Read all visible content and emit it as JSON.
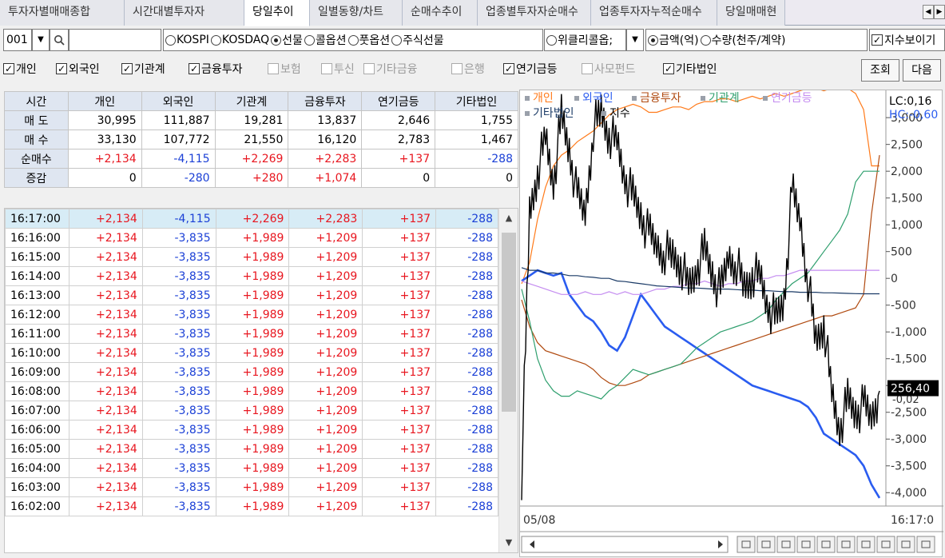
{
  "tabs": [
    {
      "label": "투자자별매매종합",
      "active": false
    },
    {
      "label": "시간대별투자자",
      "active": false
    },
    {
      "label": "당일추이",
      "active": true
    },
    {
      "label": "일별동향/차트",
      "active": false
    },
    {
      "label": "순매수추이",
      "active": false
    },
    {
      "label": "업종별투자자순매수",
      "active": false
    },
    {
      "label": "업종투자자누적순매수",
      "active": false
    },
    {
      "label": "당일매매현",
      "active": false
    }
  ],
  "tab_scroll": {
    "left": "◀",
    "right": "▶"
  },
  "controls": {
    "code_value": "001",
    "dropdown_glyph": "▼",
    "search_glyph": "🔍",
    "markets": [
      {
        "label": "KOSPI",
        "selected": false
      },
      {
        "label": "KOSDAQ",
        "selected": false
      },
      {
        "label": "선물",
        "selected": true
      },
      {
        "label": "콜옵션",
        "selected": false
      },
      {
        "label": "풋옵션",
        "selected": false
      },
      {
        "label": "주식선물",
        "selected": false
      }
    ],
    "weekly_option": {
      "label": "위클리콜옵;",
      "selected": false
    },
    "unit_options": [
      {
        "label": "금액(억)",
        "selected": true
      },
      {
        "label": "수량(천주/계약)",
        "selected": false
      }
    ],
    "show_index": {
      "label": "지수보이기",
      "checked": true
    },
    "check_mark": "✓"
  },
  "investor_checks": [
    {
      "label": "개인",
      "checked": true
    },
    {
      "label": "외국인",
      "checked": true
    },
    {
      "label": "기관계",
      "checked": true
    },
    {
      "label": "금융투자",
      "checked": true
    },
    {
      "label": "보험",
      "checked": false
    },
    {
      "label": "투신",
      "checked": false
    },
    {
      "label": "기타금융",
      "checked": false
    },
    {
      "label": "은행",
      "checked": false
    },
    {
      "label": "연기금등",
      "checked": true
    },
    {
      "label": "사모펀드",
      "checked": false
    },
    {
      "label": "기타법인",
      "checked": true
    }
  ],
  "buttons": {
    "query": "조회",
    "next": "다음"
  },
  "summary": {
    "headers": [
      "시간",
      "개인",
      "외국인",
      "기관계",
      "금융투자",
      "연기금등",
      "기타법인"
    ],
    "rows": [
      {
        "label": "매 도",
        "values": [
          "30,995",
          "111,887",
          "19,281",
          "13,837",
          "2,646",
          "1,755"
        ]
      },
      {
        "label": "매 수",
        "values": [
          "33,130",
          "107,772",
          "21,550",
          "16,120",
          "2,783",
          "1,467"
        ]
      },
      {
        "label": "순매수",
        "values": [
          "+2,134",
          "-4,115",
          "+2,269",
          "+2,283",
          "+137",
          "-288"
        ]
      },
      {
        "label": "증감",
        "values": [
          "0",
          "-280",
          "+280",
          "+1,074",
          "0",
          "0"
        ]
      }
    ]
  },
  "time_rows": [
    {
      "time": "16:17:00",
      "values": [
        "+2,134",
        "-4,115",
        "+2,269",
        "+2,283",
        "+137",
        "-288"
      ]
    },
    {
      "time": "16:16:00",
      "values": [
        "+2,134",
        "-3,835",
        "+1,989",
        "+1,209",
        "+137",
        "-288"
      ]
    },
    {
      "time": "16:15:00",
      "values": [
        "+2,134",
        "-3,835",
        "+1,989",
        "+1,209",
        "+137",
        "-288"
      ]
    },
    {
      "time": "16:14:00",
      "values": [
        "+2,134",
        "-3,835",
        "+1,989",
        "+1,209",
        "+137",
        "-288"
      ]
    },
    {
      "time": "16:13:00",
      "values": [
        "+2,134",
        "-3,835",
        "+1,989",
        "+1,209",
        "+137",
        "-288"
      ]
    },
    {
      "time": "16:12:00",
      "values": [
        "+2,134",
        "-3,835",
        "+1,989",
        "+1,209",
        "+137",
        "-288"
      ]
    },
    {
      "time": "16:11:00",
      "values": [
        "+2,134",
        "-3,835",
        "+1,989",
        "+1,209",
        "+137",
        "-288"
      ]
    },
    {
      "time": "16:10:00",
      "values": [
        "+2,134",
        "-3,835",
        "+1,989",
        "+1,209",
        "+137",
        "-288"
      ]
    },
    {
      "time": "16:09:00",
      "values": [
        "+2,134",
        "-3,835",
        "+1,989",
        "+1,209",
        "+137",
        "-288"
      ]
    },
    {
      "time": "16:08:00",
      "values": [
        "+2,134",
        "-3,835",
        "+1,989",
        "+1,209",
        "+137",
        "-288"
      ]
    },
    {
      "time": "16:07:00",
      "values": [
        "+2,134",
        "-3,835",
        "+1,989",
        "+1,209",
        "+137",
        "-288"
      ]
    },
    {
      "time": "16:06:00",
      "values": [
        "+2,134",
        "-3,835",
        "+1,989",
        "+1,209",
        "+137",
        "-288"
      ]
    },
    {
      "time": "16:05:00",
      "values": [
        "+2,134",
        "-3,835",
        "+1,989",
        "+1,209",
        "+137",
        "-288"
      ]
    },
    {
      "time": "16:04:00",
      "values": [
        "+2,134",
        "-3,835",
        "+1,989",
        "+1,209",
        "+137",
        "-288"
      ]
    },
    {
      "time": "16:03:00",
      "values": [
        "+2,134",
        "-3,835",
        "+1,989",
        "+1,209",
        "+137",
        "-288"
      ]
    },
    {
      "time": "16:02:00",
      "values": [
        "+2,134",
        "-3,835",
        "+1,989",
        "+1,209",
        "+137",
        "-288"
      ]
    }
  ],
  "scroll_glyphs": {
    "up": "▲",
    "down": "▼"
  },
  "colors": {
    "positive": "#e8161f",
    "negative": "#1a3fd6",
    "selected_row": "#d7ecf6",
    "header_bg": "#dfe6f1"
  },
  "chart_data": {
    "type": "line",
    "x_start_label": "05/08",
    "x_end_label": "16:17:0",
    "lc_label": "LC:0,16",
    "hc_label": "HC:-0,60",
    "price_tag": "256,40",
    "legend": [
      {
        "name": "개인",
        "color": "#ff7a1a"
      },
      {
        "name": "외국인",
        "color": "#2a5cf0"
      },
      {
        "name": "금융투자",
        "color": "#b04a10"
      },
      {
        "name": "기관계",
        "color": "#2f9f6e"
      },
      {
        "name": "연기금등",
        "color": "#c48cf0"
      },
      {
        "name": "기타법인",
        "color": "#1a3a66"
      },
      {
        "name": "지수",
        "color": "#000000"
      }
    ],
    "y_ticks": [
      3000,
      2500,
      2000,
      1500,
      1000,
      500,
      0,
      -500,
      -1000,
      -1500,
      -2000,
      -2500,
      -3000,
      -3500,
      -4000
    ],
    "y_tick_labels": [
      "3,000",
      "2,500",
      "2,000",
      "1,500",
      "1,000",
      "500",
      "0",
      "-500",
      "-1,000",
      "-1,500",
      "-2,000",
      "-2,500",
      "-3,000",
      "-3,500",
      "-4,000"
    ],
    "extra_label": "-0,02",
    "ylim": [
      -4250,
      3450
    ],
    "n_points": 46,
    "series": [
      {
        "name": "개인",
        "color": "#ff7a1a",
        "width": 1.2,
        "values": [
          -100,
          300,
          1100,
          1700,
          2100,
          2300,
          2400,
          2550,
          2650,
          2750,
          2900,
          3050,
          3150,
          3200,
          3250,
          3200,
          3100,
          3100,
          3150,
          3200,
          3200,
          3150,
          3250,
          3300,
          3300,
          3350,
          3350,
          3300,
          3350,
          3400,
          3350,
          3400,
          3450,
          3400,
          3450,
          3500,
          3550,
          3550,
          3500,
          3550,
          3600,
          3550,
          3450,
          3150,
          2100,
          2100
        ]
      },
      {
        "name": "외국인",
        "color": "#2a5cf0",
        "width": 2.6,
        "values": [
          -50,
          50,
          150,
          100,
          50,
          100,
          -300,
          -500,
          -700,
          -800,
          -1000,
          -1250,
          -1350,
          -1100,
          -700,
          -300,
          -500,
          -700,
          -900,
          -1000,
          -1100,
          -1200,
          -1300,
          -1400,
          -1500,
          -1600,
          -1700,
          -1800,
          -1900,
          -2000,
          -2050,
          -2100,
          -2150,
          -2200,
          -2250,
          -2300,
          -2400,
          -2600,
          -2900,
          -3000,
          -3100,
          -3200,
          -3300,
          -3500,
          -3850,
          -4100
        ]
      },
      {
        "name": "금융투자",
        "color": "#b04a10",
        "width": 1.2,
        "values": [
          -400,
          -900,
          -1200,
          -1350,
          -1400,
          -1450,
          -1500,
          -1550,
          -1600,
          -1700,
          -1850,
          -1950,
          -2000,
          -2000,
          -1950,
          -1900,
          -1800,
          -1750,
          -1700,
          -1650,
          -1600,
          -1550,
          -1500,
          -1450,
          -1400,
          -1350,
          -1300,
          -1250,
          -1200,
          -1150,
          -1100,
          -1050,
          -1000,
          -950,
          -900,
          -850,
          -800,
          -750,
          -700,
          -700,
          -650,
          -600,
          -550,
          -300,
          1200,
          2300
        ]
      },
      {
        "name": "기관계",
        "color": "#2f9f6e",
        "width": 1.2,
        "values": [
          -200,
          -800,
          -1500,
          -1900,
          -2100,
          -2200,
          -2200,
          -2100,
          -2150,
          -2200,
          -2250,
          -2100,
          -2000,
          -1850,
          -1700,
          -1750,
          -1800,
          -1750,
          -1700,
          -1650,
          -1600,
          -1450,
          -1300,
          -1200,
          -1100,
          -1000,
          -950,
          -900,
          -850,
          -800,
          -700,
          -600,
          -400,
          -250,
          -100,
          0,
          100,
          300,
          500,
          700,
          900,
          1200,
          1800,
          2000,
          2000,
          2000
        ]
      },
      {
        "name": "연기금등",
        "color": "#c48cf0",
        "width": 1.2,
        "values": [
          -50,
          -100,
          -150,
          -200,
          -250,
          -300,
          -300,
          -300,
          -250,
          -300,
          -300,
          -250,
          -300,
          -250,
          -300,
          -300,
          -250,
          -200,
          -200,
          -150,
          -150,
          -100,
          -100,
          -50,
          -100,
          -150,
          -100,
          -100,
          -50,
          -50,
          0,
          0,
          50,
          50,
          100,
          150,
          150,
          150,
          150,
          150,
          150,
          150,
          150,
          150,
          150,
          150
        ]
      },
      {
        "name": "기타법인",
        "color": "#1a3a66",
        "width": 1.2,
        "values": [
          200,
          150,
          150,
          100,
          100,
          80,
          50,
          50,
          30,
          20,
          0,
          0,
          -50,
          -60,
          -80,
          -100,
          -120,
          -140,
          -150,
          -160,
          -170,
          -180,
          -180,
          -190,
          -200,
          -200,
          -200,
          -210,
          -220,
          -220,
          -230,
          -230,
          -240,
          -250,
          -250,
          -260,
          -260,
          -260,
          -270,
          -270,
          -275,
          -280,
          -285,
          -288,
          -288,
          -288
        ]
      },
      {
        "name": "지수",
        "color": "#000000",
        "width": 1.4,
        "jagged": true,
        "values": [
          -3700,
          1200,
          2000,
          2600,
          1800,
          3000,
          2400,
          1500,
          1200,
          2800,
          3100,
          2700,
          2500,
          1900,
          1500,
          1200,
          800,
          600,
          500,
          400,
          300,
          -200,
          200,
          500,
          100,
          -300,
          400,
          300,
          -200,
          100,
          0,
          -500,
          -800,
          -400,
          1600,
          1100,
          0,
          -1200,
          -800,
          -2200,
          -2800,
          -2300,
          -2500,
          -2400,
          -2600,
          -2100
        ]
      }
    ]
  }
}
